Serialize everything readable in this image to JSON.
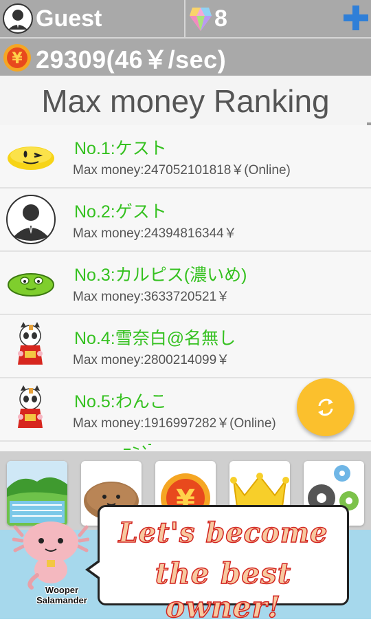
{
  "header": {
    "user_name": "Guest",
    "gem_count": "8",
    "money_text": "29309(46￥/sec)"
  },
  "ranking": {
    "title": "Max money Ranking",
    "rows": [
      {
        "name": "No.1:ケスト",
        "money": "Max money:247052101818￥(Online)",
        "icon": "yellow-smiley-icon"
      },
      {
        "name": "No.2:ゲスト",
        "money": "Max money:24394816344￥",
        "icon": "guest-avatar-icon"
      },
      {
        "name": "No.3:カルピス(濃いめ)",
        "money": "Max money:3633720521￥",
        "icon": "green-blob-icon"
      },
      {
        "name": "No.4:雪奈白@名無し",
        "money": "Max money:2800214099￥",
        "icon": "panda-cat-icon"
      },
      {
        "name": "No.5:わんこ",
        "money": "Max money:1916997282￥(Online)",
        "icon": "panda-cat-icon"
      }
    ]
  },
  "fab": {
    "icon": "refresh-icon"
  },
  "tabs": [
    {
      "icon": "rice-field-icon"
    },
    {
      "icon": "potato-character-icon"
    },
    {
      "icon": "yen-coin-icon"
    },
    {
      "icon": "crown-icon"
    },
    {
      "icon": "gears-icon"
    }
  ],
  "banner": {
    "line1": "Let's become",
    "line2": "the best owner!",
    "mascot_line1": "Wooper",
    "mascot_line2": "Salamander"
  },
  "colors": {
    "header_bg": "#a9a9a9",
    "rank_name": "#35c120",
    "fab": "#fbc02d",
    "banner_bg": "#a6d8ec",
    "slogan_stroke": "#d2231f"
  }
}
